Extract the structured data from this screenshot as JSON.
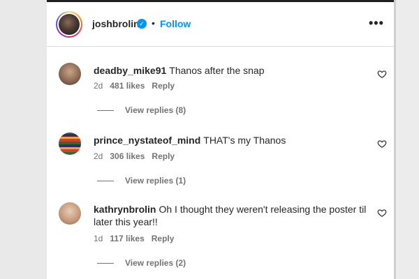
{
  "post": {
    "username": "joshbrolin",
    "separator": "•",
    "follow_label": "Follow",
    "more_icon": "more-horizontal-icon",
    "verified_mark": "✓"
  },
  "comments": [
    {
      "username": "deadby_mike91",
      "text": "Thanos after the snap",
      "time": "2d",
      "likes": "481 likes",
      "reply_label": "Reply",
      "view_replies": "View replies (8)"
    },
    {
      "username": "prince_nystateof_mind",
      "text": "THAT's my Thanos",
      "time": "2d",
      "likes": "306 likes",
      "reply_label": "Reply",
      "view_replies": "View replies (1)"
    },
    {
      "username": "kathrynbrolin",
      "text": "Oh I thought they weren't releasing the poster til later this year!!",
      "time": "1d",
      "likes": "117 likes",
      "reply_label": "Reply",
      "view_replies": "View replies (2)"
    }
  ],
  "colors": {
    "accent": "#0095f6",
    "text": "#262626",
    "secondary": "#737373"
  }
}
